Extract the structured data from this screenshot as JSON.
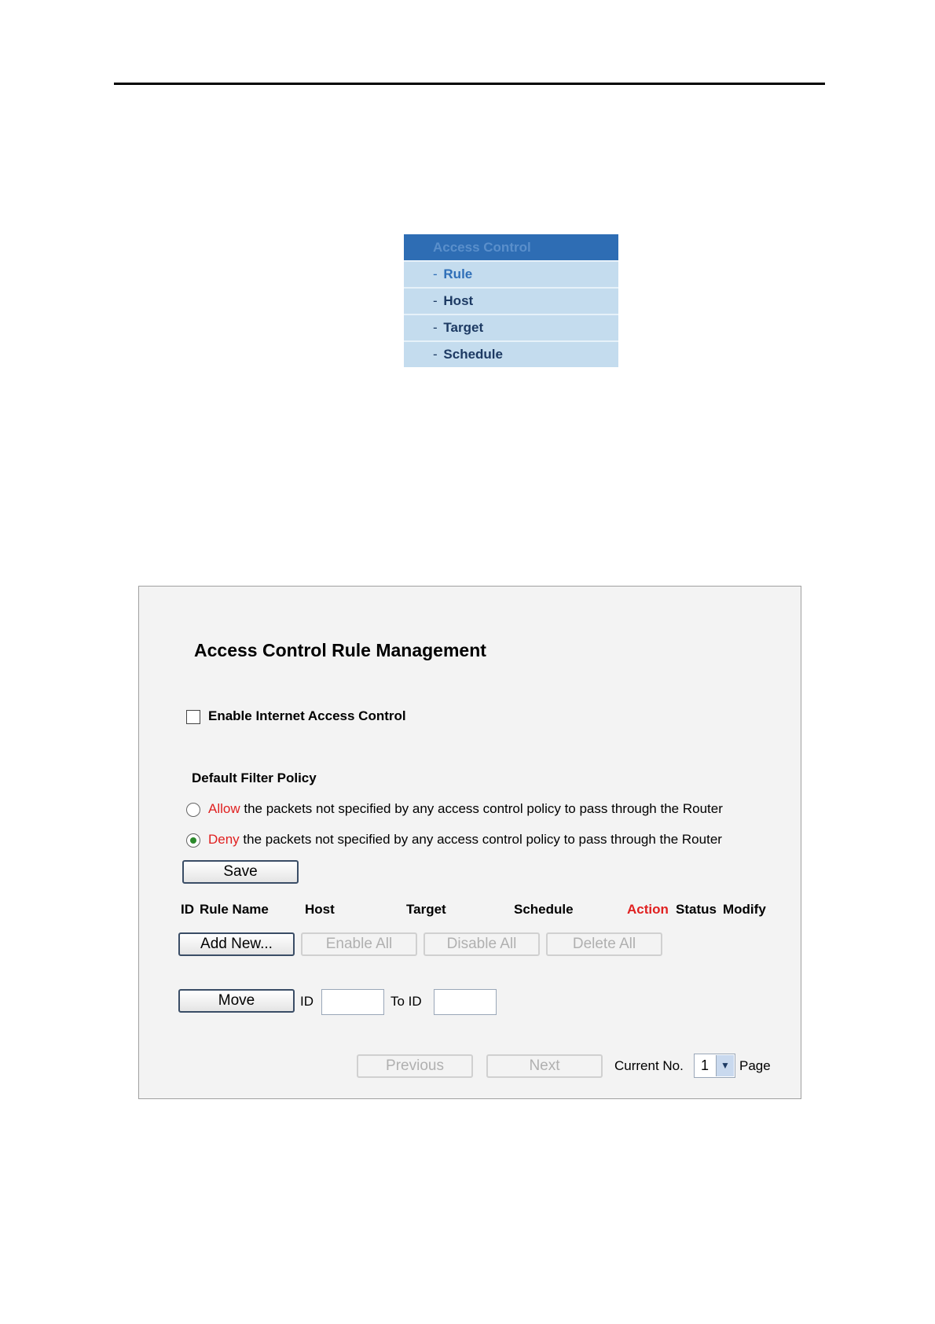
{
  "menu": {
    "header": "Access Control",
    "dash": "-",
    "items": [
      "Rule",
      "Host",
      "Target",
      "Schedule"
    ]
  },
  "panel": {
    "title": "Access Control Rule Management",
    "enable_label": "Enable Internet Access Control",
    "enable_checked": false,
    "policy_heading": "Default Filter Policy",
    "allow_word": "Allow",
    "allow_rest": "the packets not specified by any access control policy to pass through the Router",
    "deny_word": "Deny",
    "deny_rest": "the packets not specified by any access control policy to pass through the Router",
    "selected_policy": "Deny",
    "save_label": "Save",
    "columns": {
      "id": "ID",
      "rule_name": "Rule Name",
      "host": "Host",
      "target": "Target",
      "schedule": "Schedule",
      "action": "Action",
      "status": "Status",
      "modify": "Modify"
    },
    "buttons": {
      "add_new": "Add New...",
      "enable_all": "Enable All",
      "disable_all": "Disable All",
      "delete_all": "Delete All",
      "move": "Move",
      "previous": "Previous",
      "next": "Next"
    },
    "move": {
      "id_label": "ID",
      "to_id_label": "To ID",
      "id_value": "",
      "to_id_value": ""
    },
    "paging": {
      "current_label": "Current No.",
      "current_value": "1",
      "page_label": "Page"
    },
    "colors": {
      "accent_red": "#e02020",
      "menu_header": "#2e6db4",
      "menu_item": "#c4dcee"
    }
  }
}
